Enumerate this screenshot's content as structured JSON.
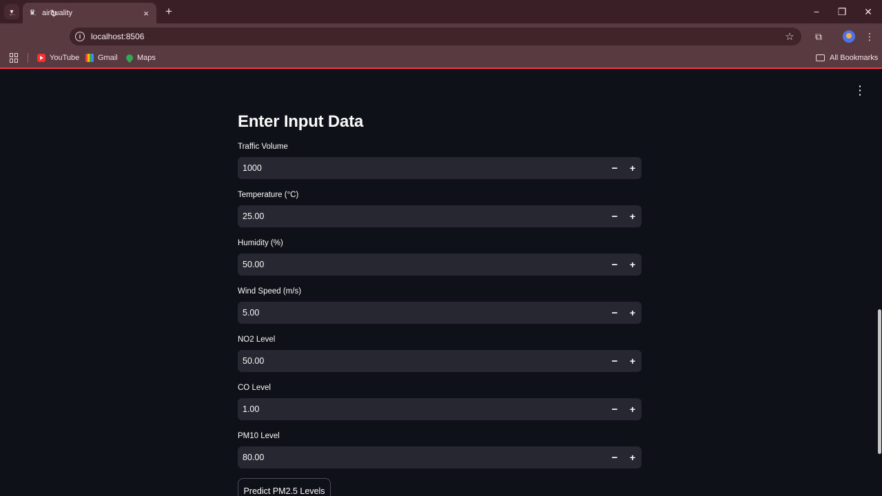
{
  "browser": {
    "tab_title": "airquality",
    "url": "localhost:8506",
    "bookmarks": [
      {
        "label": "YouTube",
        "icon": "youtube-icon"
      },
      {
        "label": "Gmail",
        "icon": "gmail-icon"
      },
      {
        "label": "Maps",
        "icon": "maps-icon"
      }
    ],
    "all_bookmarks_label": "All Bookmarks",
    "icons": {
      "tab_menu": "chevron-down-icon",
      "close": "close-icon",
      "new_tab": "plus-icon",
      "back": "arrow-left-icon",
      "forward": "arrow-right-icon",
      "reload": "reload-icon",
      "site_info": "info-icon",
      "bookmark": "star-icon",
      "extensions": "puzzle-icon",
      "menu": "kebab-menu-icon"
    },
    "accent_color": "#ff3347"
  },
  "app": {
    "heading": "Enter Input Data",
    "fields": [
      {
        "label": "Traffic Volume",
        "value": "1000"
      },
      {
        "label": "Temperature (°C)",
        "value": "25.00"
      },
      {
        "label": "Humidity (%)",
        "value": "50.00"
      },
      {
        "label": "Wind Speed (m/s)",
        "value": "5.00"
      },
      {
        "label": "NO2 Level",
        "value": "50.00"
      },
      {
        "label": "CO Level",
        "value": "1.00"
      },
      {
        "label": "PM10 Level",
        "value": "80.00"
      }
    ],
    "stepper": {
      "minus": "−",
      "plus": "+"
    },
    "predict_button": "Predict PM2.5 Levels",
    "menu_icon": "kebab-menu-icon"
  }
}
